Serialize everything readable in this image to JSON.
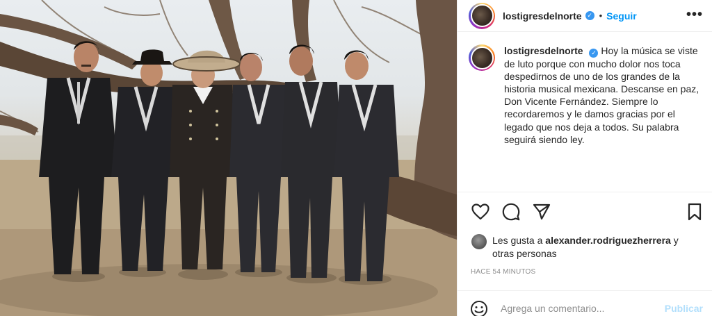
{
  "post": {
    "username": "lostigresdelnorte",
    "verified_glyph": "✓",
    "separator": "•",
    "follow_label": "Seguir",
    "more_label": "•••",
    "caption_username": "lostigresdelnorte",
    "caption": "Hoy la música se viste de luto porque con mucho dolor nos toca despedirnos de uno de los grandes de la historia musical mexicana. Descanse en paz, Don Vicente Fernández. Siempre lo recordaremos y le damos gracias por el legado que nos deja a todos. Su palabra seguirá siendo ley.",
    "likes_prefix": "Les gusta a",
    "likes_user": "alexander.rodriguezherrera",
    "likes_suffix": "y otras personas",
    "timestamp": "HACE 54 MINUTOS",
    "comment_placeholder": "Agrega un comentario...",
    "publish_label": "Publicar"
  },
  "icons": {
    "like": "heart-icon",
    "comment": "comment-icon",
    "share": "paper-plane-icon",
    "save": "bookmark-icon",
    "emoji": "emoji-icon",
    "more": "more-options-icon"
  },
  "colors": {
    "link_blue": "#0095f6",
    "verified_blue": "#3897f0",
    "muted_gray": "#8e8e8e",
    "publish_disabled": "#b2dffc",
    "text": "#262626"
  }
}
